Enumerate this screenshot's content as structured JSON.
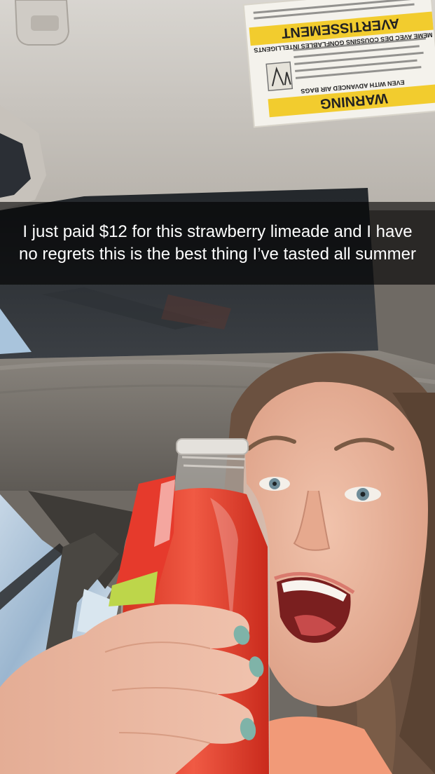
{
  "caption": {
    "text": "I just paid $12 for this strawberry limeade and I have no regrets this is the best thing I’ve tasted all summer"
  },
  "visor_label": {
    "warning_heading": "WARNING",
    "warning_sub": "EVEN WITH ADVANCED AIR BAGS",
    "avertissement_heading": "AVERTISSEMENT",
    "avertissement_sub": "MEME AVEC DES COUSSINS GONFLABLES INTELLIGENTS"
  },
  "colors": {
    "caption_bg": "#000000",
    "caption_text": "#ffffff",
    "label_yellow": "#f2cc2e",
    "drink_red": "#e8402f",
    "nail_teal": "#7fb3a8"
  }
}
